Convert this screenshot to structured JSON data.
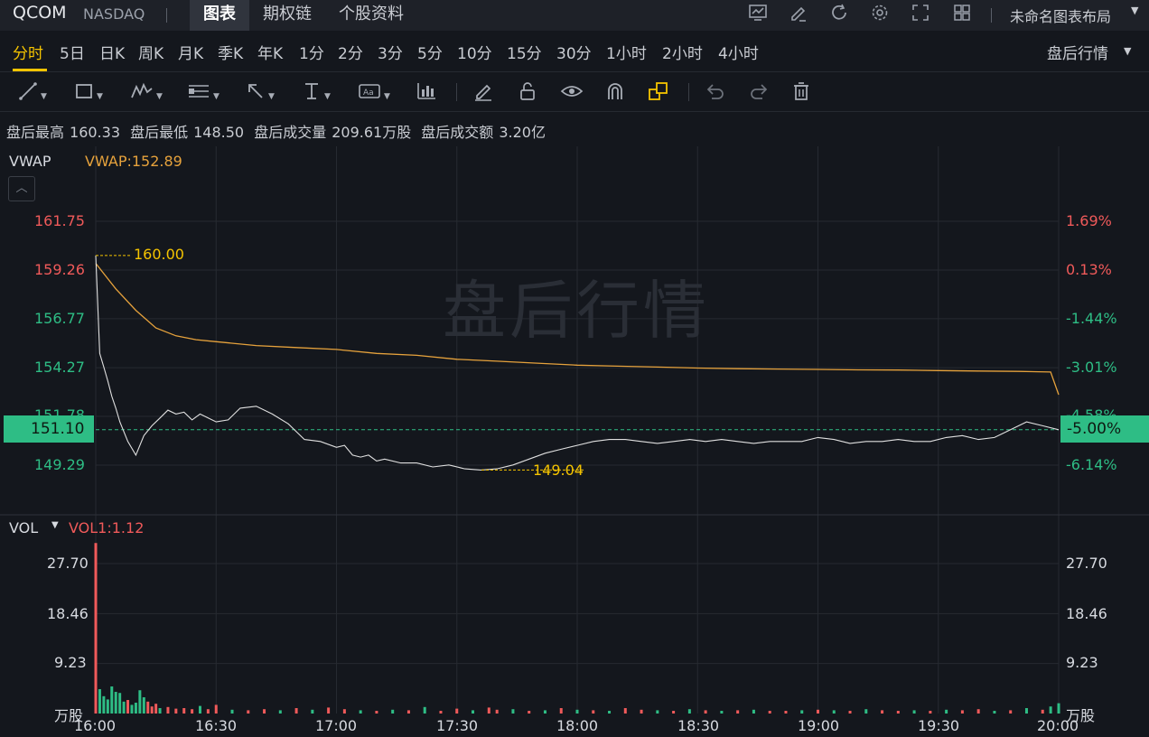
{
  "header": {
    "symbol": "QCOM",
    "exchange": "NASDAQ",
    "tabs": [
      {
        "label": "图表",
        "active": true
      },
      {
        "label": "期权链",
        "active": false
      },
      {
        "label": "个股资料",
        "active": false
      }
    ],
    "layout_name": "未命名图表布局",
    "icons": [
      "indicator-chart-icon",
      "edit-icon",
      "refresh-icon",
      "settings-icon",
      "fullscreen-icon",
      "grid-layout-icon"
    ]
  },
  "periods": {
    "items": [
      "分时",
      "5日",
      "日K",
      "周K",
      "月K",
      "季K",
      "年K",
      "1分",
      "2分",
      "3分",
      "5分",
      "10分",
      "15分",
      "30分",
      "1小时",
      "2小时",
      "4小时"
    ],
    "active": "分时",
    "session": "盘后行情"
  },
  "drawing_tools": [
    "trend-line-icon",
    "rectangle-icon",
    "wave-icon",
    "fib-icon",
    "arrow-icon",
    "measure-icon",
    "text-icon",
    "bar-pattern-icon",
    "pen-icon",
    "lock-icon",
    "eye-icon",
    "magnet-icon",
    "stack-icon",
    "undo-icon",
    "redo-icon",
    "delete-icon"
  ],
  "info_bar": {
    "high_label": "盘后最高",
    "high": "160.33",
    "low_label": "盘后最低",
    "low": "148.50",
    "vol_label": "盘后成交量",
    "vol": "209.61万股",
    "amt_label": "盘后成交额",
    "amt": "3.20亿"
  },
  "price_panel": {
    "indicator": "VWAP",
    "indicator_value": "VWAP:152.89",
    "watermark": "盘后行情",
    "current_price": "151.10",
    "current_pct": "-5.00%",
    "high_marker": "160.00",
    "low_marker": "149.04",
    "colors": {
      "up": "#f05a5a",
      "down": "#2ebd85",
      "price_line": "#e0e0e0",
      "vwap": "#e6a23c",
      "marker": "#f5c400"
    }
  },
  "volume_panel": {
    "indicator": "VOL",
    "indicator_value": "VOL1:1.12",
    "unit": "万股"
  },
  "chart_data": [
    {
      "type": "line",
      "title": "",
      "x_ticks": [
        "16:00",
        "16:30",
        "17:00",
        "17:30",
        "18:00",
        "18:30",
        "19:00",
        "19:30",
        "20:00"
      ],
      "y_ticks_left": [
        "161.75",
        "159.26",
        "156.77",
        "154.27",
        "151.78",
        "149.29"
      ],
      "y_ticks_right": [
        "1.69%",
        "0.13%",
        "-1.44%",
        "-3.01%",
        "-4.58%",
        "-6.14%"
      ],
      "ylim": [
        147.5,
        163.0
      ],
      "series": [
        {
          "name": "",
          "x_minutes": [
            0,
            1,
            2,
            3,
            4,
            5,
            6,
            8,
            10,
            12,
            14,
            16,
            18,
            20,
            22,
            24,
            26,
            28,
            30,
            33,
            36,
            40,
            44,
            48,
            52,
            56,
            60,
            62,
            64,
            66,
            68,
            70,
            72,
            76,
            80,
            84,
            88,
            92,
            96,
            100,
            104,
            108,
            112,
            116,
            120,
            124,
            128,
            132,
            136,
            140,
            144,
            148,
            152,
            156,
            160,
            164,
            168,
            172,
            176,
            180,
            184,
            188,
            192,
            196,
            200,
            204,
            208,
            212,
            216,
            220,
            224,
            228,
            232,
            236,
            240
          ],
          "values": [
            160.0,
            155.0,
            154.3,
            153.6,
            152.8,
            152.2,
            151.5,
            150.5,
            149.8,
            150.8,
            151.3,
            151.7,
            152.1,
            151.9,
            152.0,
            151.6,
            151.9,
            151.7,
            151.5,
            151.6,
            152.2,
            152.3,
            151.9,
            151.4,
            150.6,
            150.5,
            150.2,
            150.3,
            149.8,
            149.7,
            149.8,
            149.5,
            149.6,
            149.4,
            149.4,
            149.2,
            149.3,
            149.1,
            149.04,
            149.1,
            149.3,
            149.6,
            149.9,
            150.1,
            150.3,
            150.5,
            150.6,
            150.6,
            150.5,
            150.4,
            150.5,
            150.6,
            150.5,
            150.6,
            150.5,
            150.4,
            150.5,
            150.5,
            150.5,
            150.7,
            150.6,
            150.4,
            150.5,
            150.5,
            150.6,
            150.5,
            150.5,
            150.7,
            150.8,
            150.6,
            150.7,
            151.1,
            151.5,
            151.3,
            151.1
          ]
        },
        {
          "name": "VWAP",
          "x_minutes": [
            0,
            5,
            10,
            15,
            20,
            25,
            30,
            40,
            50,
            60,
            70,
            80,
            90,
            100,
            110,
            120,
            130,
            140,
            150,
            160,
            170,
            180,
            190,
            200,
            210,
            220,
            230,
            238,
            240
          ],
          "values": [
            159.6,
            158.3,
            157.2,
            156.3,
            155.9,
            155.7,
            155.6,
            155.4,
            155.3,
            155.2,
            155.0,
            154.9,
            154.7,
            154.6,
            154.5,
            154.4,
            154.35,
            154.3,
            154.25,
            154.22,
            154.2,
            154.18,
            154.16,
            154.15,
            154.12,
            154.1,
            154.08,
            154.05,
            152.89
          ]
        }
      ]
    },
    {
      "type": "bar",
      "title": "",
      "x_ticks": [
        "16:00",
        "16:30",
        "17:00",
        "17:30",
        "18:00",
        "18:30",
        "19:00",
        "19:30",
        "20:00"
      ],
      "y_ticks": [
        "27.70",
        "18.46",
        "9.23"
      ],
      "ylim": [
        0,
        32
      ],
      "unit": "万股",
      "x_minutes": [
        0,
        1,
        2,
        3,
        4,
        5,
        6,
        7,
        8,
        9,
        10,
        11,
        12,
        13,
        14,
        15,
        16,
        18,
        20,
        22,
        24,
        26,
        28,
        30,
        34,
        38,
        42,
        46,
        50,
        54,
        58,
        62,
        66,
        70,
        74,
        78,
        82,
        86,
        90,
        94,
        98,
        100,
        104,
        108,
        112,
        116,
        120,
        124,
        128,
        132,
        136,
        140,
        144,
        148,
        152,
        156,
        160,
        164,
        168,
        172,
        176,
        180,
        184,
        188,
        192,
        196,
        200,
        204,
        208,
        212,
        216,
        220,
        224,
        228,
        232,
        236,
        238,
        240
      ],
      "values": [
        31.5,
        4.5,
        3.2,
        2.6,
        5.0,
        4.0,
        3.8,
        2.2,
        2.5,
        1.6,
        2.0,
        4.3,
        3.0,
        2.2,
        1.3,
        1.8,
        1.0,
        1.2,
        0.9,
        1.0,
        0.8,
        1.4,
        0.8,
        1.6,
        0.7,
        0.6,
        0.8,
        0.6,
        1.0,
        0.7,
        1.1,
        0.8,
        0.6,
        0.5,
        0.7,
        0.6,
        1.2,
        0.5,
        0.9,
        0.6,
        1.1,
        0.7,
        0.8,
        0.5,
        0.6,
        1.0,
        0.7,
        0.6,
        0.5,
        1.0,
        0.7,
        0.6,
        0.5,
        0.8,
        0.6,
        0.5,
        0.6,
        0.7,
        0.5,
        0.5,
        0.6,
        0.7,
        0.6,
        0.5,
        0.8,
        0.6,
        0.5,
        0.6,
        0.5,
        0.7,
        0.6,
        0.8,
        0.5,
        0.6,
        1.0,
        0.7,
        1.3,
        1.9
      ],
      "colors": [
        "r",
        "g",
        "g",
        "g",
        "g",
        "g",
        "g",
        "g",
        "r",
        "g",
        "g",
        "g",
        "g",
        "r",
        "r",
        "r",
        "g",
        "r",
        "r",
        "r",
        "r",
        "g",
        "r",
        "r",
        "g",
        "r",
        "r",
        "g",
        "r",
        "g",
        "r",
        "r",
        "g",
        "r",
        "g",
        "r",
        "g",
        "r",
        "r",
        "g",
        "r",
        "r",
        "g",
        "r",
        "g",
        "r",
        "g",
        "r",
        "g",
        "r",
        "r",
        "g",
        "r",
        "g",
        "r",
        "g",
        "r",
        "g",
        "r",
        "r",
        "g",
        "r",
        "g",
        "r",
        "g",
        "r",
        "r",
        "g",
        "r",
        "g",
        "r",
        "r",
        "g",
        "r",
        "g",
        "r",
        "g",
        "g"
      ]
    }
  ]
}
